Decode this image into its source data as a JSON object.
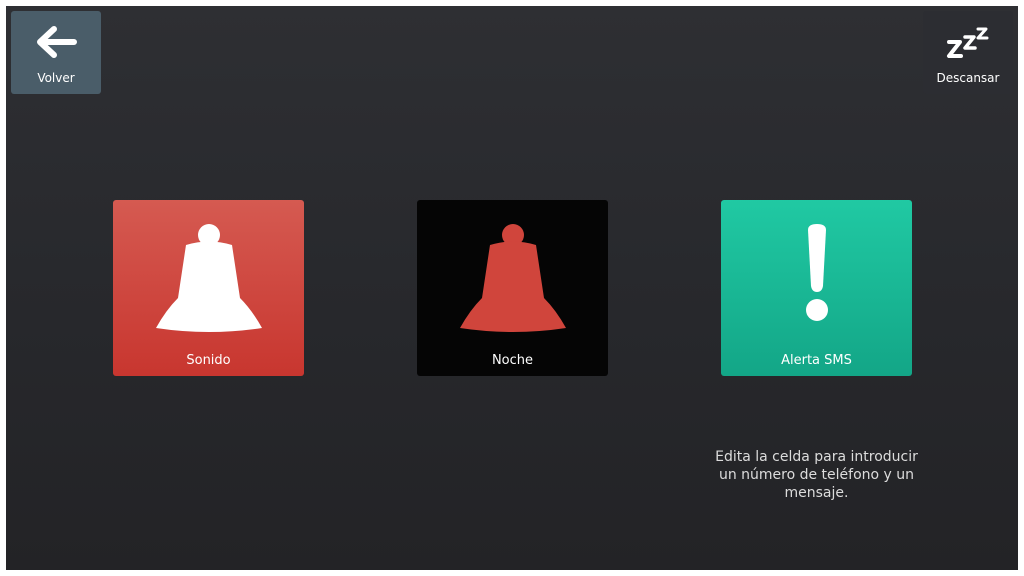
{
  "header": {
    "back_label": "Volver",
    "sleep_label": "Descansar"
  },
  "cells": [
    {
      "label": "Sonido",
      "icon": "bell-icon",
      "color": "#d04840"
    },
    {
      "label": "Noche",
      "icon": "bell-icon",
      "color": "#050505"
    },
    {
      "label": "Alerta SMS",
      "icon": "exclamation-icon",
      "color": "#19b897"
    }
  ],
  "hint_text": "Edita la celda para introducir un número de teléfono y un mensaje.",
  "colors": {
    "background": "#2b2c30",
    "back_button": "#4a5d69",
    "bell_red": "#d0453c",
    "white": "#ffffff"
  }
}
